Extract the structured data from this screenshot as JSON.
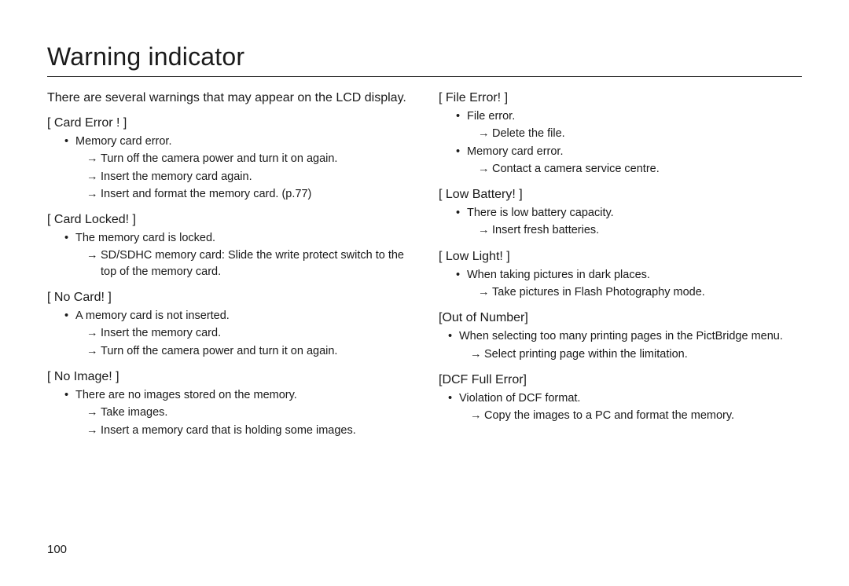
{
  "title": "Warning indicator",
  "intro": "There are several warnings that may appear on the LCD display.",
  "page_number": "100",
  "left": {
    "s1": {
      "head": "[ Card Error ! ]",
      "b1": "Memory card error.",
      "a1": "Turn off the camera power and turn it on again.",
      "a2": "Insert the memory card again.",
      "a3": "Insert and format the memory card. (p.77)"
    },
    "s2": {
      "head": "[ Card Locked! ]",
      "b1": "The memory card is locked.",
      "a1": "SD/SDHC memory card: Slide the write protect switch to the top of the memory card."
    },
    "s3": {
      "head": "[ No Card! ]",
      "b1": "A memory card is not inserted.",
      "a1": "Insert the memory card.",
      "a2": "Turn off the camera power and turn it on again."
    },
    "s4": {
      "head": "[ No Image! ]",
      "b1": "There are no images stored on the memory.",
      "a1": "Take images.",
      "a2": "Insert a memory card that is holding some images."
    }
  },
  "right": {
    "s1": {
      "head": "[ File Error! ]",
      "b1": "File error.",
      "a1": "Delete the file.",
      "b2": "Memory card error.",
      "a2": "Contact a camera service centre."
    },
    "s2": {
      "head": "[ Low Battery! ]",
      "b1": "There is low battery capacity.",
      "a1": "Insert fresh batteries."
    },
    "s3": {
      "head": "[ Low Light! ]",
      "b1": "When taking pictures in dark places.",
      "a1": "Take pictures in Flash Photography mode."
    },
    "s4": {
      "head": "[Out of Number]",
      "b1": "When selecting too many printing pages in the PictBridge menu.",
      "a1": "Select printing page within the limitation."
    },
    "s5": {
      "head": "[DCF Full Error]",
      "b1": "Violation of DCF format.",
      "a1": "Copy the images to a PC and format the memory."
    }
  }
}
